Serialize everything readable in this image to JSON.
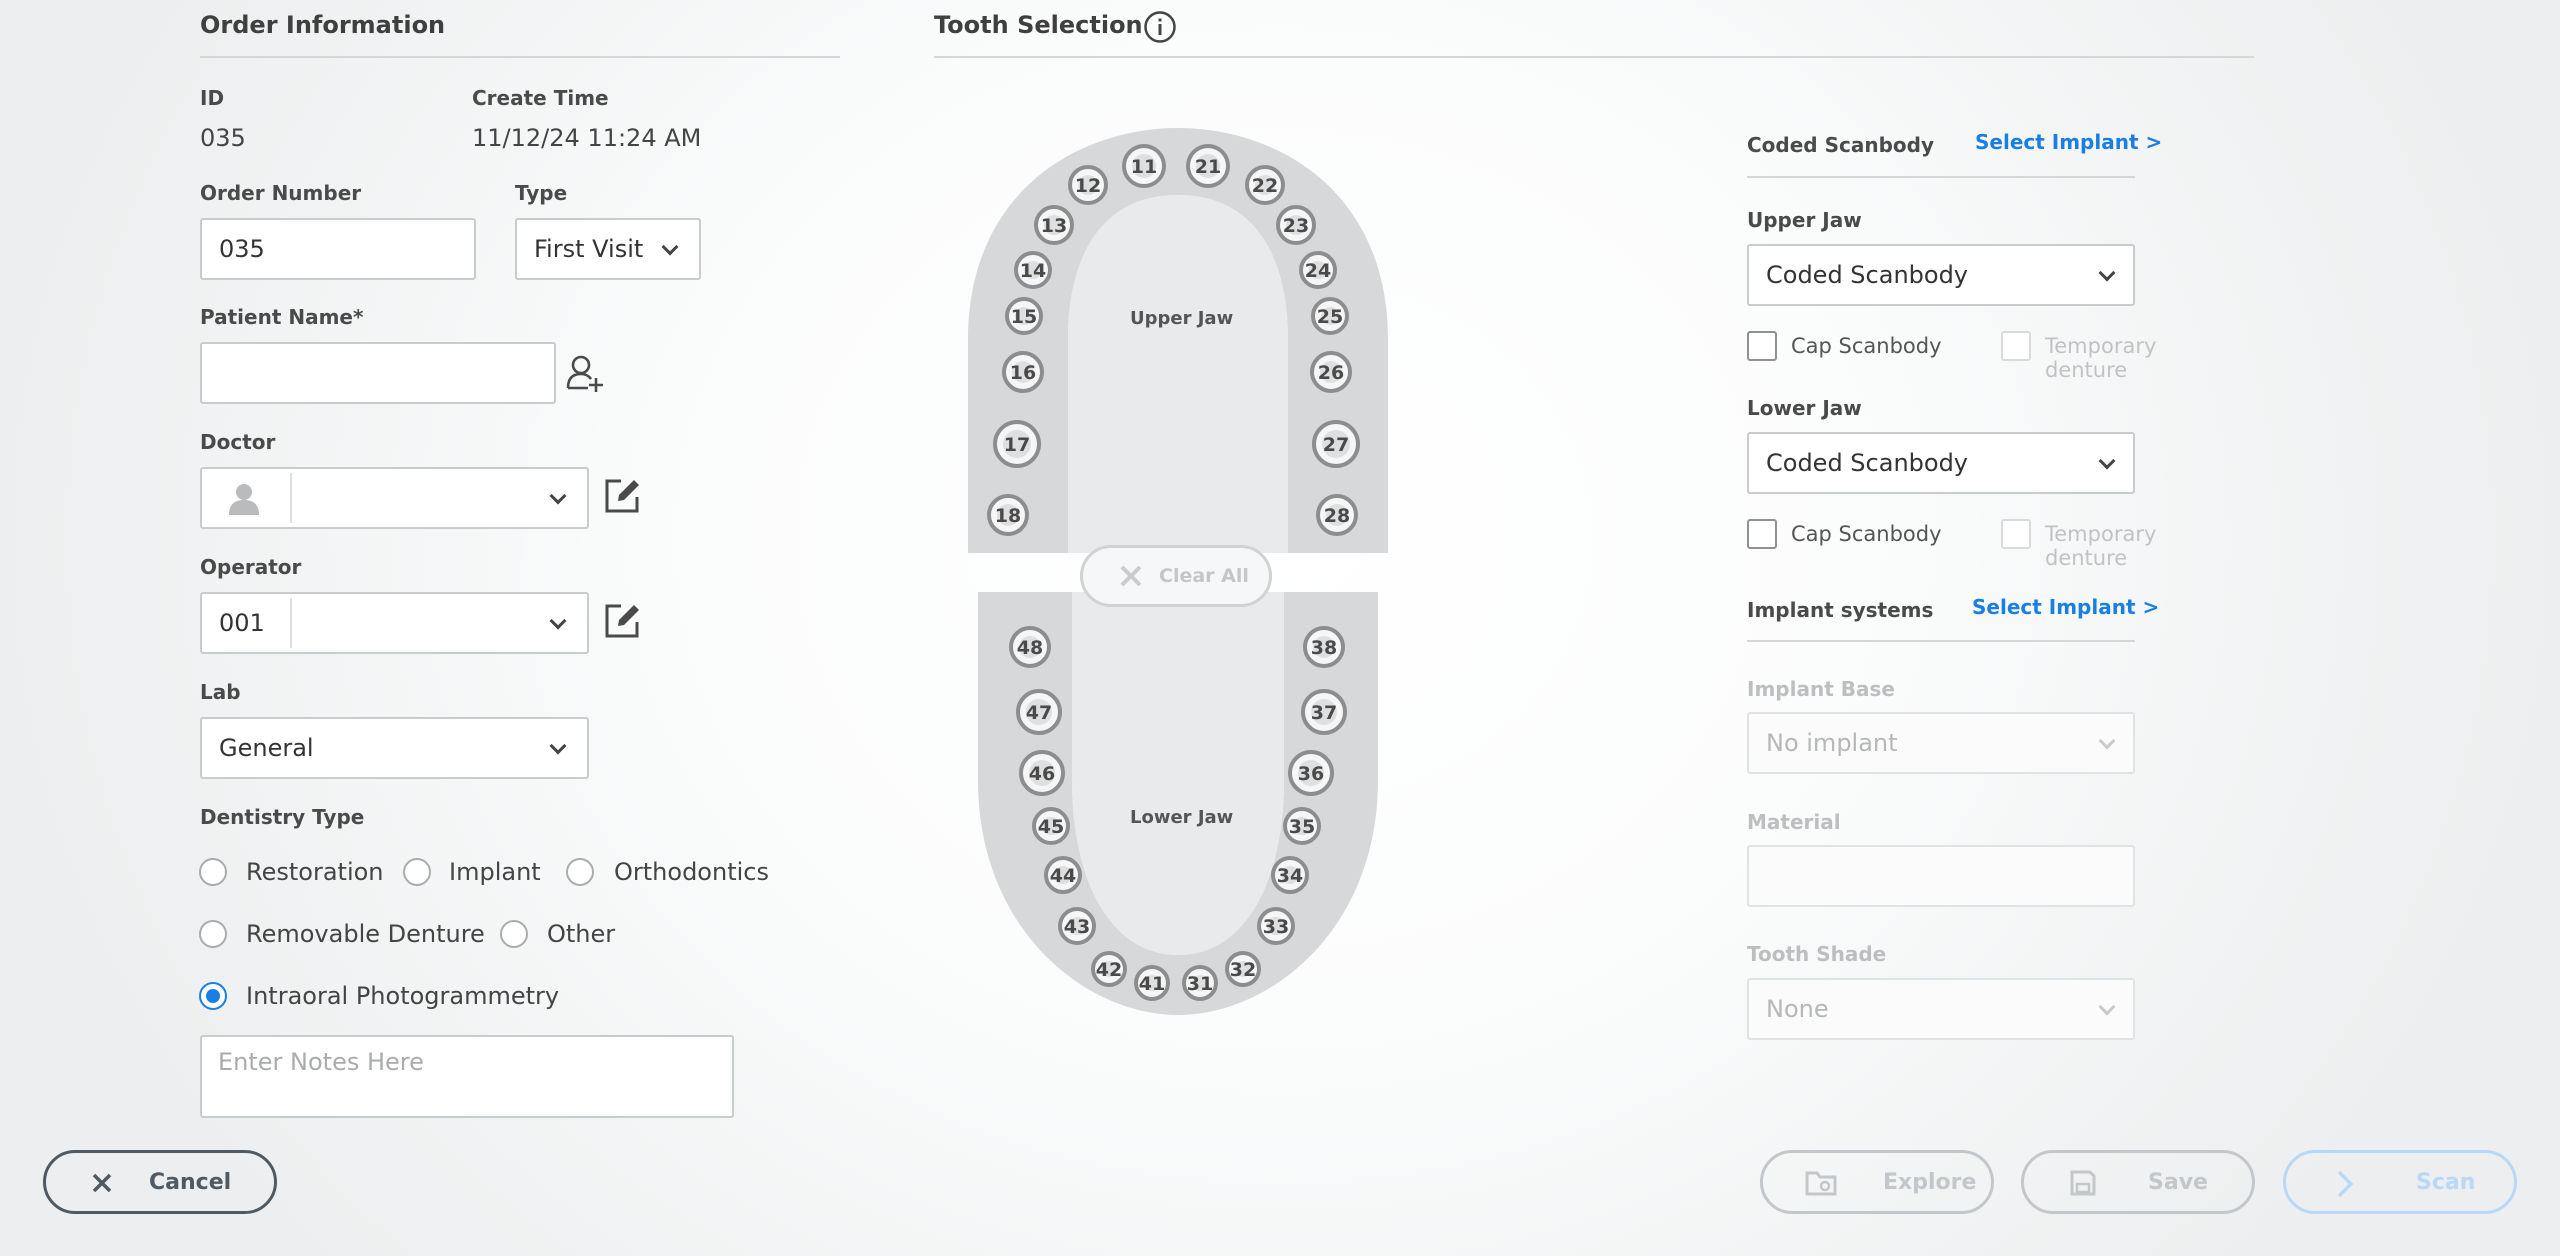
{
  "order_info": {
    "title": "Order Information",
    "id_label": "ID",
    "id_value": "035",
    "create_time_label": "Create Time",
    "create_time_value": "11/12/24 11:24 AM",
    "order_number_label": "Order Number",
    "order_number_value": "035",
    "type_label": "Type",
    "type_value": "First Visit",
    "patient_name_label": "Patient Name*",
    "patient_name_value": "",
    "doctor_label": "Doctor",
    "doctor_value": "",
    "operator_label": "Operator",
    "operator_id": "001",
    "operator_value": "",
    "lab_label": "Lab",
    "lab_value": "General",
    "dentistry_type_label": "Dentistry Type",
    "dentistry_options": [
      "Restoration",
      "Implant",
      "Orthodontics",
      "Removable Denture",
      "Other",
      "Intraoral Photogrammetry"
    ],
    "dentistry_selected": "Intraoral Photogrammetry",
    "notes_placeholder": "Enter Notes Here"
  },
  "tooth_selection": {
    "title": "Tooth Selection",
    "upper_jaw_label": "Upper Jaw",
    "lower_jaw_label": "Lower Jaw",
    "clear_all_label": "Clear All",
    "upper_teeth": [
      "18",
      "17",
      "16",
      "15",
      "14",
      "13",
      "12",
      "11",
      "21",
      "22",
      "23",
      "24",
      "25",
      "26",
      "27",
      "28"
    ],
    "lower_teeth": [
      "48",
      "47",
      "46",
      "45",
      "44",
      "43",
      "42",
      "41",
      "31",
      "32",
      "33",
      "34",
      "35",
      "36",
      "37",
      "38"
    ]
  },
  "scanbody": {
    "coded_scanbody_label": "Coded Scanbody",
    "select_implant_link": "Select Implant >",
    "upper_jaw_label": "Upper Jaw",
    "upper_jaw_value": "Coded Scanbody",
    "lower_jaw_label": "Lower Jaw",
    "lower_jaw_value": "Coded Scanbody",
    "cap_scanbody_label": "Cap Scanbody",
    "temporary_denture_label": "Temporary denture",
    "implant_systems_label": "Implant systems",
    "implant_systems_link": "Select Implant >",
    "implant_base_label": "Implant Base",
    "implant_base_value": "No implant",
    "material_label": "Material",
    "material_value": "",
    "tooth_shade_label": "Tooth Shade",
    "tooth_shade_value": "None"
  },
  "footer": {
    "cancel_label": "Cancel",
    "explore_label": "Explore",
    "save_label": "Save",
    "scan_label": "Scan"
  },
  "colors": {
    "accent": "#1a7fe3",
    "disabled": "#c4c7ca",
    "border_dark": "#4f5a63"
  },
  "icons": [
    "info-icon",
    "add-user-icon",
    "avatar-icon",
    "edit-icon",
    "chevron-down-icon",
    "close-icon",
    "folder-icon",
    "save-icon",
    "chevron-right-icon"
  ]
}
